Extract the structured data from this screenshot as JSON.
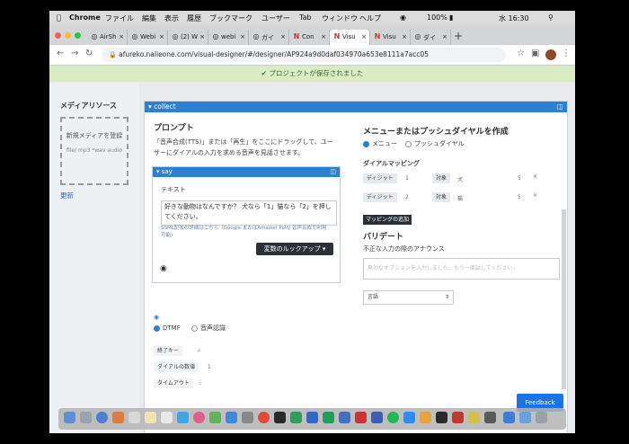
{
  "mac_menu": {
    "app": "Chrome",
    "items": [
      "ファイル",
      "編集",
      "表示",
      "履歴",
      "ブックマーク",
      "ユーザー",
      "Tab",
      "ウィンドウ",
      "ヘルプ"
    ],
    "battery": "100%",
    "clock": "水 16:30"
  },
  "tabs": [
    {
      "label": "AirSh",
      "icon": "globe-icon",
      "active": false
    },
    {
      "label": "Webi",
      "icon": "globe-icon",
      "active": false
    },
    {
      "label": "(2) W",
      "icon": "globe-icon",
      "active": false
    },
    {
      "label": "webi",
      "icon": "globe-icon",
      "active": false
    },
    {
      "label": "ガイ",
      "icon": "globe-icon",
      "active": false
    },
    {
      "label": "Con",
      "icon": "n-icon",
      "active": false
    },
    {
      "label": "Visu",
      "icon": "n-icon",
      "active": true
    },
    {
      "label": "Visu",
      "icon": "n-icon",
      "active": false
    },
    {
      "label": "ダイ",
      "icon": "globe-icon",
      "active": false
    }
  ],
  "address": {
    "url": "afureko.nalieone.com/visual-designer/#/designer/AP924a9d0daf034970a653e8111a7acc05"
  },
  "banner": {
    "text": "プロジェクトが保存されました"
  },
  "sidebar": {
    "title": "メディアリソース",
    "dropzone_title": "新規メディアを登録",
    "dropzone_hint": "file/ mp3 *wav audio",
    "more": "更新"
  },
  "panel": {
    "header": "collect",
    "prompt_heading": "プロンプト",
    "prompt_desc_1": "「音声合成(TTS)」または「再生」をここにドラッグして、ユー",
    "prompt_desc_2": "ザーにダイアルの入力を求める音声を見話させます。",
    "say_label": "say",
    "text_label": "テキスト",
    "textarea_value": "好きな動物はなんですか？ 犬なら「1」猫なら「2」を押してください。",
    "ssml_note_1": "SSML記法の詳細はこちら（Google またはAmazon Polly 音声合成で利用",
    "ssml_note_2": "可能)",
    "lookup_button": "変数のルックアップ",
    "menu_heading": "メニューまたはプッシュダイヤルを作成",
    "radio_menu": "メニュー",
    "radio_push": "プッシュダイヤル",
    "dial_mapping": "ダイアルマッピング",
    "mappings": [
      {
        "digit_label": "ディジット",
        "digit": "1",
        "target_label": "対象",
        "target": "犬",
        "num": "5"
      },
      {
        "digit_label": "ディジット",
        "digit": "2",
        "target_label": "対象",
        "target": "猫",
        "num": "5"
      }
    ],
    "add_mapping": "マッピングの追加",
    "validate_heading": "バリデート",
    "invalid_announce": "不正な入力の際のアナウンス",
    "invalid_placeholder": "無効なオプションを入力しました。もう一度試してください。",
    "lang_label": "言語",
    "dtmf": "DTMF",
    "speech": "音声認識",
    "end_key_label": "終了キー",
    "end_key_value": "#",
    "digit_count_label": "ダイアルの数値",
    "digit_count_value": "1",
    "timeout_label": "タイムアウト",
    "timeout_value": "5"
  },
  "feedback": "Feedback",
  "colors": {
    "accent": "#2f7fd0",
    "banner_bg": "#d9ecc4",
    "dark_button": "#2c3138"
  }
}
